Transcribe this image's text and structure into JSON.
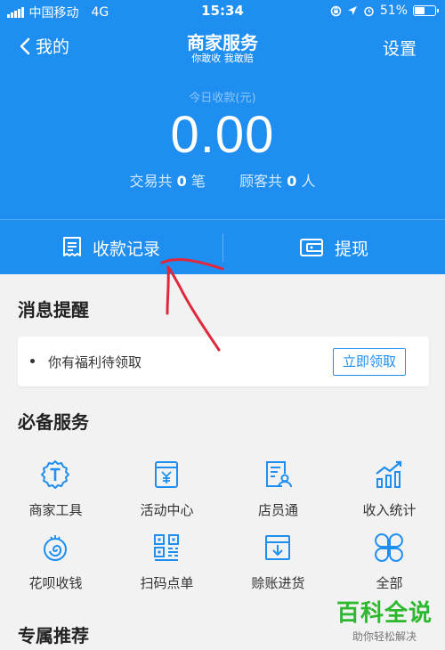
{
  "status_bar": {
    "carrier": "中国移动",
    "network": "4G",
    "time": "15:34",
    "battery": "51%",
    "battery_level": 0.51
  },
  "nav": {
    "back_label": "我的",
    "title": "商家服务",
    "subtitle": "你敢收 我敢赔",
    "settings_label": "设置"
  },
  "summary": {
    "label": "今日收款(元)",
    "amount": "0.00",
    "transactions_prefix": "交易共",
    "transactions_count": "0",
    "transactions_suffix": "笔",
    "customers_prefix": "顾客共",
    "customers_count": "0",
    "customers_suffix": "人"
  },
  "actions": {
    "records_label": "收款记录",
    "withdraw_label": "提现"
  },
  "messages": {
    "title": "消息提醒",
    "notice_text": "你有福利待领取",
    "claim_label": "立即领取"
  },
  "services": {
    "title": "必备服务",
    "items": [
      {
        "label": "商家工具",
        "icon": "merchant-tools-icon"
      },
      {
        "label": "活动中心",
        "icon": "activity-center-icon"
      },
      {
        "label": "店员通",
        "icon": "staff-icon"
      },
      {
        "label": "收入统计",
        "icon": "income-stats-icon"
      },
      {
        "label": "花呗收钱",
        "icon": "huabei-icon"
      },
      {
        "label": "扫码点单",
        "icon": "qr-order-icon"
      },
      {
        "label": "赊账进货",
        "icon": "credit-purchase-icon"
      },
      {
        "label": "全部",
        "icon": "all-services-icon"
      }
    ]
  },
  "recommend": {
    "title": "专属推荐"
  },
  "watermark": {
    "title": "百科全说",
    "subtitle": "助你轻松解决"
  },
  "colors": {
    "primary": "#1e8ef0",
    "background": "#f2f2f2",
    "watermark": "#2eb82e",
    "annotation": "#e0283c"
  }
}
